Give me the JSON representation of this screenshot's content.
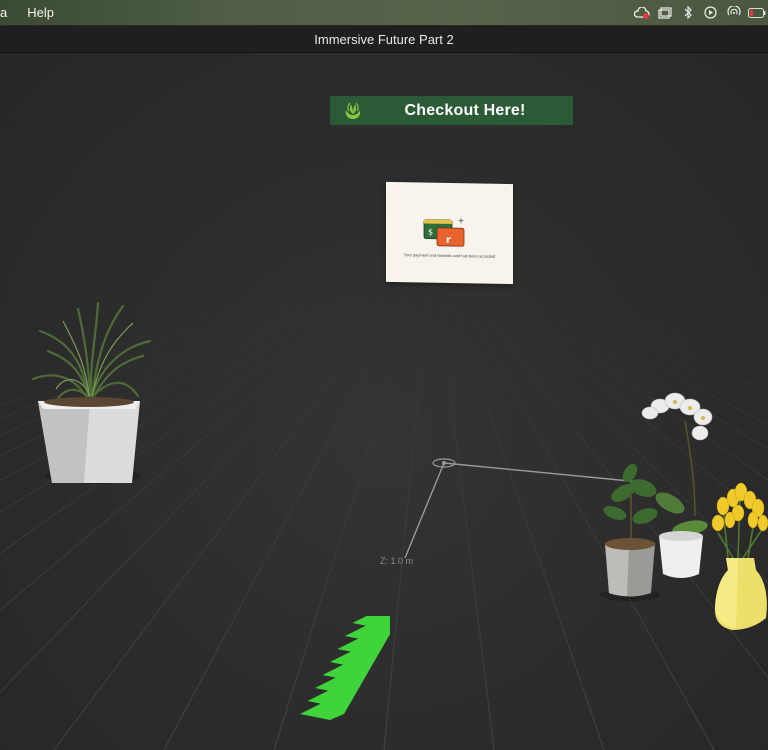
{
  "menubar": {
    "app_fragment": "a",
    "help_label": "Help",
    "status_icons": [
      "creative-cloud-icon",
      "window-icon",
      "bluetooth-icon",
      "play-icon",
      "airdrop-icon",
      "battery-icon"
    ]
  },
  "window": {
    "title": "Immersive Future Part 2"
  },
  "scene": {
    "checkout_banner": {
      "text": "Checkout Here!",
      "logo_icon": "woolworths-logo-icon",
      "color": "#2b5a37"
    },
    "payment_panel": {
      "icon": "payment-cards-icon",
      "card_symbols": [
        "$",
        "r"
      ],
      "message": "Your payment and rewards card has been accepted"
    },
    "axis_label": "Z:  1.0 m",
    "guide_arrow_color": "#3fd43a",
    "objects": [
      "potted-grass-plant",
      "orchid-plant",
      "potted-fig-plant",
      "yellow-tulips-vase"
    ]
  }
}
